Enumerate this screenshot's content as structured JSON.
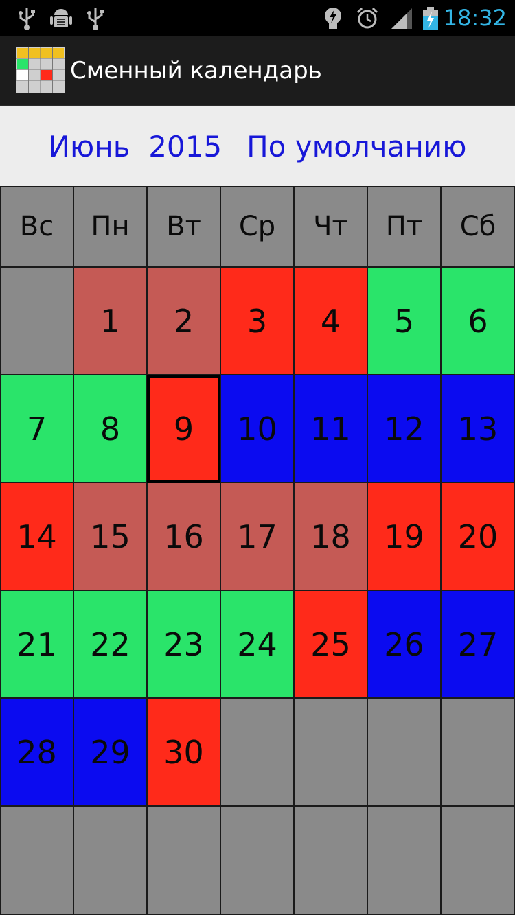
{
  "status_bar": {
    "time": "18:32",
    "left_icons": [
      "usb-icon",
      "android-debug-icon",
      "usb-icon"
    ],
    "right_icons": [
      "lightbulb-notification-icon",
      "alarm-clock-icon",
      "signal-icon",
      "battery-charging-icon"
    ],
    "time_color": "#33b5e5"
  },
  "app_bar": {
    "title": "Сменный календарь",
    "logo_icon": "calendar-app-icon"
  },
  "header": {
    "month_year": "Июнь  2015",
    "schedule": "По умолчанию",
    "text_color": "#1717d8"
  },
  "calendar": {
    "weekdays": [
      "Вс",
      "Пн",
      "Вт",
      "Ср",
      "Чт",
      "Пт",
      "Сб"
    ],
    "colors": {
      "empty": "#8a8a8a",
      "rose": "#c55a55",
      "red": "#ff2a1a",
      "green": "#2ae46a",
      "blue": "#0b0bf0"
    },
    "selected_day": "9",
    "weeks": [
      [
        {
          "day": "",
          "shift": "empty"
        },
        {
          "day": "1",
          "shift": "rose"
        },
        {
          "day": "2",
          "shift": "rose"
        },
        {
          "day": "3",
          "shift": "red"
        },
        {
          "day": "4",
          "shift": "red"
        },
        {
          "day": "5",
          "shift": "green"
        },
        {
          "day": "6",
          "shift": "green"
        }
      ],
      [
        {
          "day": "7",
          "shift": "green"
        },
        {
          "day": "8",
          "shift": "green"
        },
        {
          "day": "9",
          "shift": "red"
        },
        {
          "day": "10",
          "shift": "blue"
        },
        {
          "day": "11",
          "shift": "blue"
        },
        {
          "day": "12",
          "shift": "blue"
        },
        {
          "day": "13",
          "shift": "blue"
        }
      ],
      [
        {
          "day": "14",
          "shift": "red"
        },
        {
          "day": "15",
          "shift": "rose"
        },
        {
          "day": "16",
          "shift": "rose"
        },
        {
          "day": "17",
          "shift": "rose"
        },
        {
          "day": "18",
          "shift": "rose"
        },
        {
          "day": "19",
          "shift": "red"
        },
        {
          "day": "20",
          "shift": "red"
        }
      ],
      [
        {
          "day": "21",
          "shift": "green"
        },
        {
          "day": "22",
          "shift": "green"
        },
        {
          "day": "23",
          "shift": "green"
        },
        {
          "day": "24",
          "shift": "green"
        },
        {
          "day": "25",
          "shift": "red"
        },
        {
          "day": "26",
          "shift": "blue"
        },
        {
          "day": "27",
          "shift": "blue"
        }
      ],
      [
        {
          "day": "28",
          "shift": "blue"
        },
        {
          "day": "29",
          "shift": "blue"
        },
        {
          "day": "30",
          "shift": "red"
        },
        {
          "day": "",
          "shift": "empty"
        },
        {
          "day": "",
          "shift": "empty"
        },
        {
          "day": "",
          "shift": "empty"
        },
        {
          "day": "",
          "shift": "empty"
        }
      ],
      [
        {
          "day": "",
          "shift": "empty"
        },
        {
          "day": "",
          "shift": "empty"
        },
        {
          "day": "",
          "shift": "empty"
        },
        {
          "day": "",
          "shift": "empty"
        },
        {
          "day": "",
          "shift": "empty"
        },
        {
          "day": "",
          "shift": "empty"
        },
        {
          "day": "",
          "shift": "empty"
        }
      ]
    ]
  }
}
